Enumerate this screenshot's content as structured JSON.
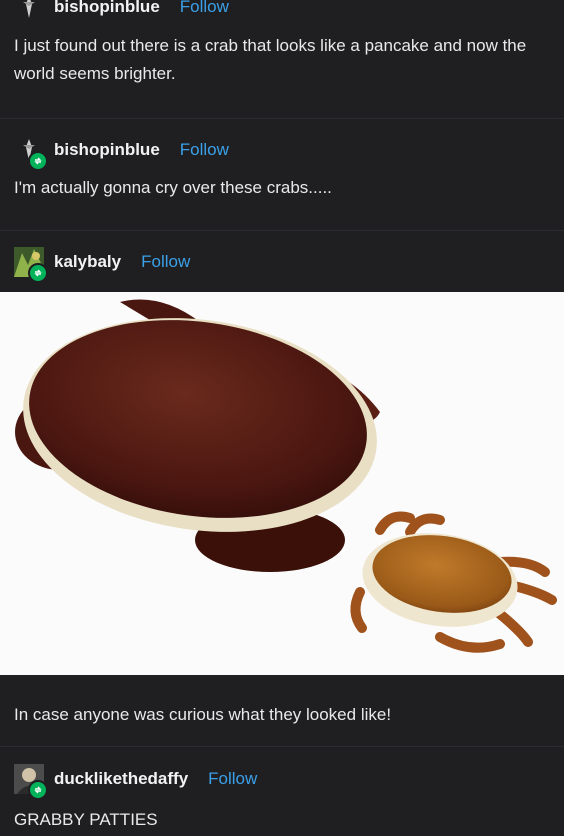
{
  "posts": [
    {
      "username": "bishopinblue",
      "follow_label": "Follow",
      "text": "I just found out there is a crab that looks like a pancake and now the world seems brighter."
    },
    {
      "username": "bishopinblue",
      "follow_label": "Follow",
      "text": "I'm actually gonna cry over these crabs....."
    },
    {
      "username": "kalybaly",
      "follow_label": "Follow",
      "caption": "In case anyone was curious what they looked like!"
    },
    {
      "username": "ducklikethedaffy",
      "follow_label": "Follow",
      "text": "GRABBY PATTIES"
    }
  ],
  "colors": {
    "background": "#1f1f22",
    "follow_link": "#3aa0e8",
    "reblog_badge": "#00b35a"
  },
  "icons": {
    "reblog_badge": "reblog-icon",
    "avatars": [
      "bishopinblue-avatar",
      "kalybaly-avatar",
      "ducklikethedaffy-avatar"
    ]
  }
}
